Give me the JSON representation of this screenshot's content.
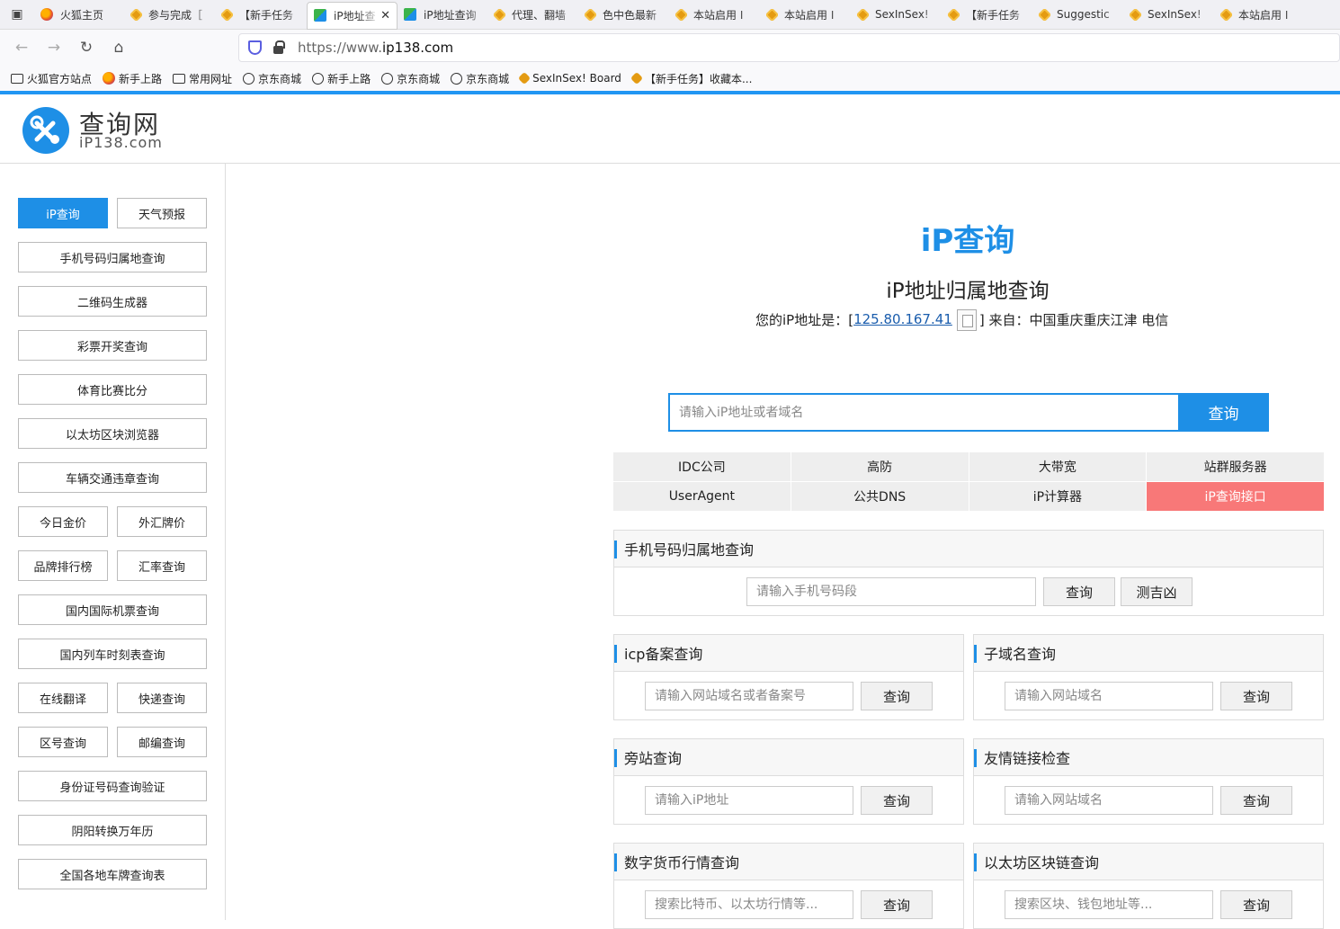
{
  "browser": {
    "tabs": [
      {
        "title": "火狐主页",
        "icon": "firefox-icon"
      },
      {
        "title": "参与完成［",
        "icon": "gear-icon"
      },
      {
        "title": "【新手任务",
        "icon": "gear-icon"
      },
      {
        "title": "iP地址查",
        "icon": "puzzle-icon",
        "active": true
      },
      {
        "title": "iP地址查询",
        "icon": "puzzle-icon"
      },
      {
        "title": "代理、翻墙",
        "icon": "gear-icon"
      },
      {
        "title": "色中色最新",
        "icon": "gear-icon"
      },
      {
        "title": "本站启用 I",
        "icon": "gear-icon"
      },
      {
        "title": "本站启用 I",
        "icon": "gear-icon"
      },
      {
        "title": "SexInSex!",
        "icon": "gear-icon"
      },
      {
        "title": "【新手任务",
        "icon": "gear-icon"
      },
      {
        "title": "Suggestic",
        "icon": "gear-icon"
      },
      {
        "title": "SexInSex!",
        "icon": "gear-icon"
      },
      {
        "title": "本站启用 I",
        "icon": "gear-icon"
      }
    ],
    "url_scheme": "https://www.",
    "url_host": "ip138.com",
    "bookmarks": [
      {
        "label": "火狐官方站点",
        "icon": "folder"
      },
      {
        "label": "新手上路",
        "icon": "firefox"
      },
      {
        "label": "常用网址",
        "icon": "folder"
      },
      {
        "label": "京东商城",
        "icon": "globe"
      },
      {
        "label": "新手上路",
        "icon": "globe"
      },
      {
        "label": "京东商城",
        "icon": "globe"
      },
      {
        "label": "京东商城",
        "icon": "globe"
      },
      {
        "label": "SexInSex! Board",
        "icon": "gear"
      },
      {
        "label": "【新手任务】收藏本...",
        "icon": "gear"
      }
    ]
  },
  "site": {
    "logo_title": "查询网",
    "logo_sub": "iP138.com"
  },
  "sidebar": {
    "items": [
      {
        "label": "iP查询",
        "active": true
      },
      {
        "label": "天气预报"
      },
      {
        "label": "手机号码归属地查询"
      },
      {
        "label": "二维码生成器"
      },
      {
        "label": "彩票开奖查询"
      },
      {
        "label": "体育比赛比分"
      },
      {
        "label": "以太坊区块浏览器"
      },
      {
        "label": "车辆交通违章查询"
      },
      {
        "label": "今日金价"
      },
      {
        "label": "外汇牌价"
      },
      {
        "label": "品牌排行榜"
      },
      {
        "label": "汇率查询"
      },
      {
        "label": "国内国际机票查询"
      },
      {
        "label": "国内列车时刻表查询"
      },
      {
        "label": "在线翻译"
      },
      {
        "label": "快递查询"
      },
      {
        "label": "区号查询"
      },
      {
        "label": "邮编查询"
      },
      {
        "label": "身份证号码查询验证"
      },
      {
        "label": "阴阳转换万年历"
      },
      {
        "label": "全国各地车牌查询表"
      }
    ]
  },
  "main": {
    "title": "iP查询",
    "subtitle": "iP地址归属地查询",
    "ip_prefix": "您的iP地址是：[",
    "ip_address": "125.80.167.41",
    "ip_suffix": "] 来自：中国重庆重庆江津 电信",
    "search_placeholder": "请输入iP地址或者域名",
    "search_button": "查询",
    "quick_links": [
      {
        "label": "IDC公司"
      },
      {
        "label": "高防"
      },
      {
        "label": "大带宽"
      },
      {
        "label": "站群服务器"
      },
      {
        "label": "UserAgent"
      },
      {
        "label": "公共DNS"
      },
      {
        "label": "iP计算器"
      },
      {
        "label": "iP查询接口",
        "highlight": "#f87878"
      }
    ]
  },
  "panels": {
    "phone": {
      "title": "手机号码归属地查询",
      "placeholder": "请输入手机号码段",
      "button": "查询",
      "button2": "测吉凶"
    },
    "icp": {
      "title": "icp备案查询",
      "placeholder": "请输入网站域名或者备案号",
      "button": "查询"
    },
    "subdomain": {
      "title": "子域名查询",
      "placeholder": "请输入网站域名",
      "button": "查询"
    },
    "sidesite": {
      "title": "旁站查询",
      "placeholder": "请输入iP地址",
      "button": "查询"
    },
    "friendlink": {
      "title": "友情链接检查",
      "placeholder": "请输入网站域名",
      "button": "查询"
    },
    "crypto": {
      "title": "数字货币行情查询",
      "placeholder": "搜索比特币、以太坊行情等...",
      "button": "查询"
    },
    "eth": {
      "title": "以太坊区块链查询",
      "placeholder": "搜索区块、钱包地址等...",
      "button": "查询"
    }
  },
  "colors": {
    "accent": "#1e8fe6",
    "highlight": "#f87878"
  }
}
